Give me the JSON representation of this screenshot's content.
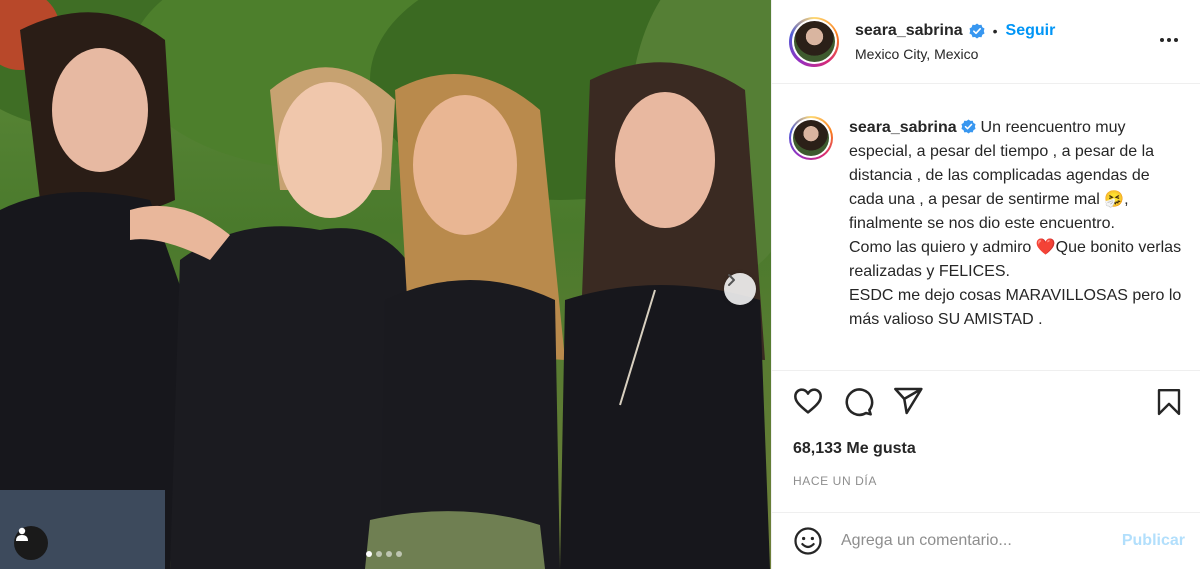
{
  "post": {
    "username": "seara_sabrina",
    "separator": "•",
    "follow_label": "Seguir",
    "location": "Mexico City, Mexico",
    "caption_user": "seara_sabrina",
    "caption_text": "Un reencuentro muy especial, a pesar del tiempo , a pesar de la distancia , de las complicadas agendas de cada una , a pesar de sentirme mal 🤧, finalmente se nos dio este encuentro.\nComo las quiero y admiro ❤️Que bonito verlas realizadas y FELICES.\nESDC me dejo cosas MARAVILLOSAS pero lo más valioso SU AMISTAD .",
    "likes": "68,133 Me gusta",
    "time": "HACE UN DÍA",
    "comment_placeholder": "Agrega un comentario...",
    "publish_label": "Publicar"
  },
  "carousel": {
    "total_slides": 4,
    "active_slide": 1
  },
  "colors": {
    "link": "#0095f6",
    "publish_disabled": "#b2dffc",
    "verified": "#3897f0"
  },
  "icons": [
    "verified-icon",
    "more-options-icon",
    "heart-icon",
    "comment-icon",
    "share-icon",
    "bookmark-icon",
    "emoji-icon",
    "chevron-right-icon",
    "user-tag-icon"
  ]
}
